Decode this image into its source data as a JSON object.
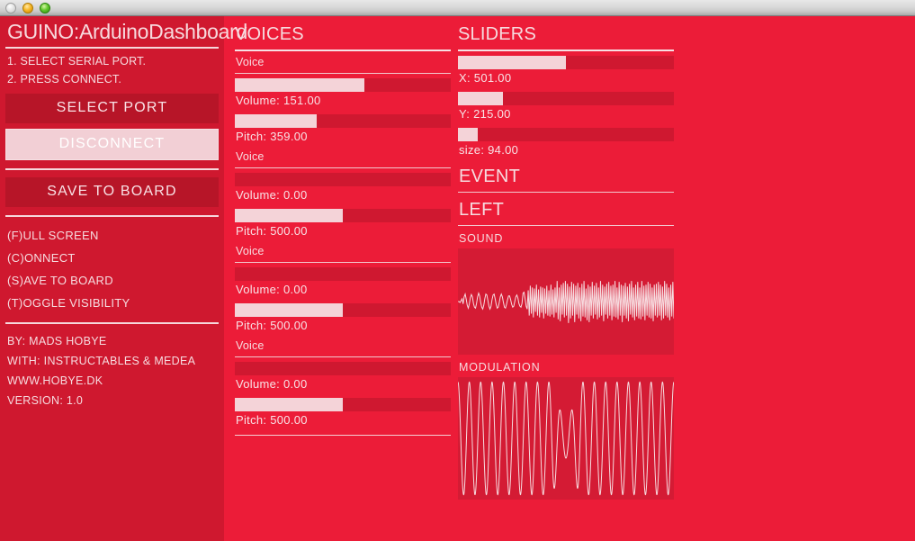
{
  "window": {
    "lights": [
      "close-button",
      "minimize-button",
      "maximize-button"
    ]
  },
  "sidebar": {
    "app_title": "GUINO:ArduinoDashboard",
    "steps": [
      "1. SELECT SERIAL PORT.",
      "2. PRESS CONNECT."
    ],
    "select_port_label": "SELECT PORT",
    "disconnect_label": "DISCONNECT",
    "save_to_board_label": "SAVE TO BOARD",
    "shortcuts": [
      "(F)ULL SCREEN",
      "(C)ONNECT",
      "(S)AVE TO BOARD",
      "(T)OGGLE VISIBILITY"
    ],
    "credits": [
      "BY: MADS HOBYE",
      "WITH: INSTRUCTABLES & MEDEA",
      "WWW.HOBYE.DK",
      "VERSION: 1.0"
    ]
  },
  "voices": {
    "heading": "VOICES",
    "items": [
      {
        "label": "Voice",
        "volume_label": "Volume: 151.00",
        "volume_pct": 60,
        "pitch_label": "Pitch: 359.00",
        "pitch_pct": 38
      },
      {
        "label": "Voice",
        "volume_label": "Volume: 0.00",
        "volume_pct": 0,
        "pitch_label": "Pitch: 500.00",
        "pitch_pct": 50
      },
      {
        "label": "Voice",
        "volume_label": "Volume: 0.00",
        "volume_pct": 0,
        "pitch_label": "Pitch: 500.00",
        "pitch_pct": 50
      },
      {
        "label": "Voice",
        "volume_label": "Volume: 0.00",
        "volume_pct": 0,
        "pitch_label": "Pitch: 500.00",
        "pitch_pct": 50
      }
    ]
  },
  "sliders": {
    "heading": "SLIDERS",
    "items": [
      {
        "label": "X: 501.00",
        "pct": 50
      },
      {
        "label": "Y: 215.00",
        "pct": 21
      },
      {
        "label": "size: 94.00",
        "pct": 9
      }
    ]
  },
  "event": {
    "heading": "EVENT",
    "value": "LEFT"
  },
  "graphs": [
    {
      "heading": "SOUND",
      "name": "sound-graph"
    },
    {
      "heading": "MODULATION",
      "name": "modulation-graph"
    }
  ],
  "colors": {
    "background": "#ec1c38",
    "sidebar": "#cf182f",
    "slider_track": "#cf1830",
    "slider_fill": "#f4d3d8",
    "text": "#f6dbdf",
    "button": "#b71528",
    "button_active": "#f2cfd5",
    "graph_bg": "#d41b34",
    "graph_line": "#f7dde1"
  },
  "chart_data": [
    {
      "type": "line",
      "title": "SOUND",
      "xlabel": "",
      "ylabel": "",
      "ylim": [
        -1,
        1
      ],
      "description": "Audio waveform: low-amplitude slow oscillation on the left half, transitioning to dense higher-frequency noise on the right half.",
      "values": [
        0.0,
        0.0,
        -0.02,
        0.02,
        0.06,
        -0.05,
        0.1,
        0.16,
        0.05,
        -0.08,
        -0.14,
        -0.05,
        0.08,
        0.15,
        0.1,
        -0.04,
        -0.12,
        -0.14,
        -0.04,
        0.1,
        0.18,
        0.12,
        -0.02,
        -0.12,
        -0.16,
        -0.08,
        0.06,
        0.16,
        0.14,
        0.02,
        -0.1,
        -0.16,
        -0.1,
        0.04,
        0.14,
        0.16,
        0.06,
        -0.06,
        -0.14,
        -0.12,
        -0.02,
        0.1,
        0.16,
        0.1,
        -0.02,
        -0.12,
        -0.14,
        -0.06,
        0.04,
        0.12,
        0.12,
        0.04,
        -0.06,
        -0.12,
        -0.1,
        0.0,
        0.1,
        0.14,
        0.08,
        -0.04,
        -0.1,
        -0.12,
        -0.04,
        0.18,
        0.2,
        0.06,
        -0.1,
        -0.16,
        0.24,
        -0.3,
        0.34,
        -0.26,
        0.3,
        -0.34,
        0.28,
        -0.22,
        0.36,
        -0.3,
        0.26,
        -0.34,
        0.32,
        -0.24,
        0.3,
        -0.36,
        0.28,
        -0.26,
        0.34,
        -0.3,
        0.24,
        -0.32,
        0.36,
        -0.28,
        0.26,
        -0.34,
        0.3,
        -0.24,
        0.44,
        -0.38,
        0.3,
        -0.42,
        0.36,
        -0.28,
        0.4,
        -0.34,
        0.44,
        -0.3,
        0.38,
        -0.46,
        0.32,
        -0.36,
        0.42,
        -0.3,
        0.38,
        -0.44,
        0.34,
        -0.28,
        0.4,
        -0.36,
        0.3,
        -0.42,
        0.38,
        -0.32,
        0.44,
        -0.34,
        0.28,
        -0.4,
        0.36,
        -0.44,
        0.32,
        -0.3,
        0.42,
        -0.36,
        0.34,
        -0.28,
        0.4,
        -0.38,
        0.3,
        -0.34,
        0.44,
        -0.3,
        0.36,
        -0.42,
        0.32,
        -0.28,
        0.38,
        -0.36,
        0.42,
        -0.3,
        0.34,
        -0.4,
        0.36,
        -0.32,
        0.44,
        -0.34,
        0.3,
        -0.38,
        0.42,
        -0.3,
        0.36,
        -0.44,
        0.34,
        -0.3,
        0.4,
        -0.36,
        0.32,
        -0.42,
        0.38,
        -0.28,
        0.44,
        -0.34,
        0.3,
        -0.4,
        0.36,
        -0.32,
        0.42,
        -0.36,
        0.3,
        -0.38,
        0.44,
        -0.32,
        0.34,
        -0.4,
        0.36,
        -0.3,
        0.42,
        -0.34,
        0.38,
        -0.36,
        0.3,
        -0.42,
        0.36,
        -0.3,
        0.38,
        -0.34,
        0.42,
        -0.3,
        0.36,
        -0.4,
        0.32,
        -0.36,
        0.44,
        -0.3,
        0.38,
        -0.34,
        0.3,
        -0.4,
        0.36,
        -0.32,
        0.42,
        -0.36
      ]
    },
    {
      "type": "line",
      "title": "MODULATION",
      "xlabel": "",
      "ylabel": "",
      "ylim": [
        -1,
        1
      ],
      "description": "Modulation waveform: ~19 full-amplitude sine-like cycles across the width, with a dip to roughly one-third amplitude around 45-55% of the width.",
      "cycles": 19,
      "amplitude": 1.0,
      "dip_start_pct": 44,
      "dip_end_pct": 56,
      "dip_amplitude": 0.35
    }
  ]
}
